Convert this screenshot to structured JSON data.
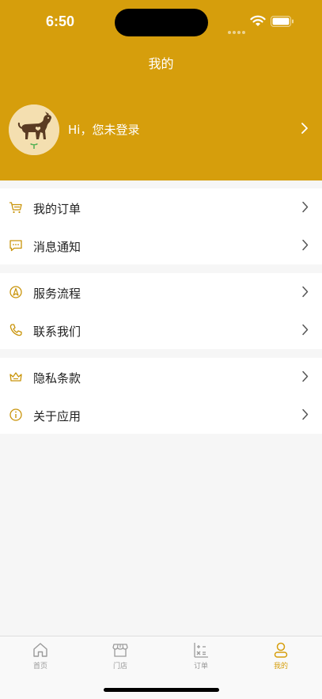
{
  "status": {
    "time": "6:50"
  },
  "header": {
    "title": "我的",
    "bg_color": "#d69e0c"
  },
  "profile": {
    "login_text": "Hi，您未登录"
  },
  "menu_groups": [
    [
      {
        "label": "我的订单",
        "icon": "cart-icon"
      },
      {
        "label": "消息通知",
        "icon": "message-icon"
      }
    ],
    [
      {
        "label": "服务流程",
        "icon": "compass-icon"
      },
      {
        "label": "联系我们",
        "icon": "phone-icon"
      }
    ],
    [
      {
        "label": "隐私条款",
        "icon": "crown-icon"
      },
      {
        "label": "关于应用",
        "icon": "info-icon"
      }
    ]
  ],
  "tabbar": {
    "tabs": [
      {
        "label": "首页",
        "icon": "home-icon"
      },
      {
        "label": "门店",
        "icon": "store-icon"
      },
      {
        "label": "订单",
        "icon": "calculator-icon"
      },
      {
        "label": "我的",
        "icon": "person-icon",
        "active": true
      }
    ]
  },
  "accent_color": "#d69e0c"
}
